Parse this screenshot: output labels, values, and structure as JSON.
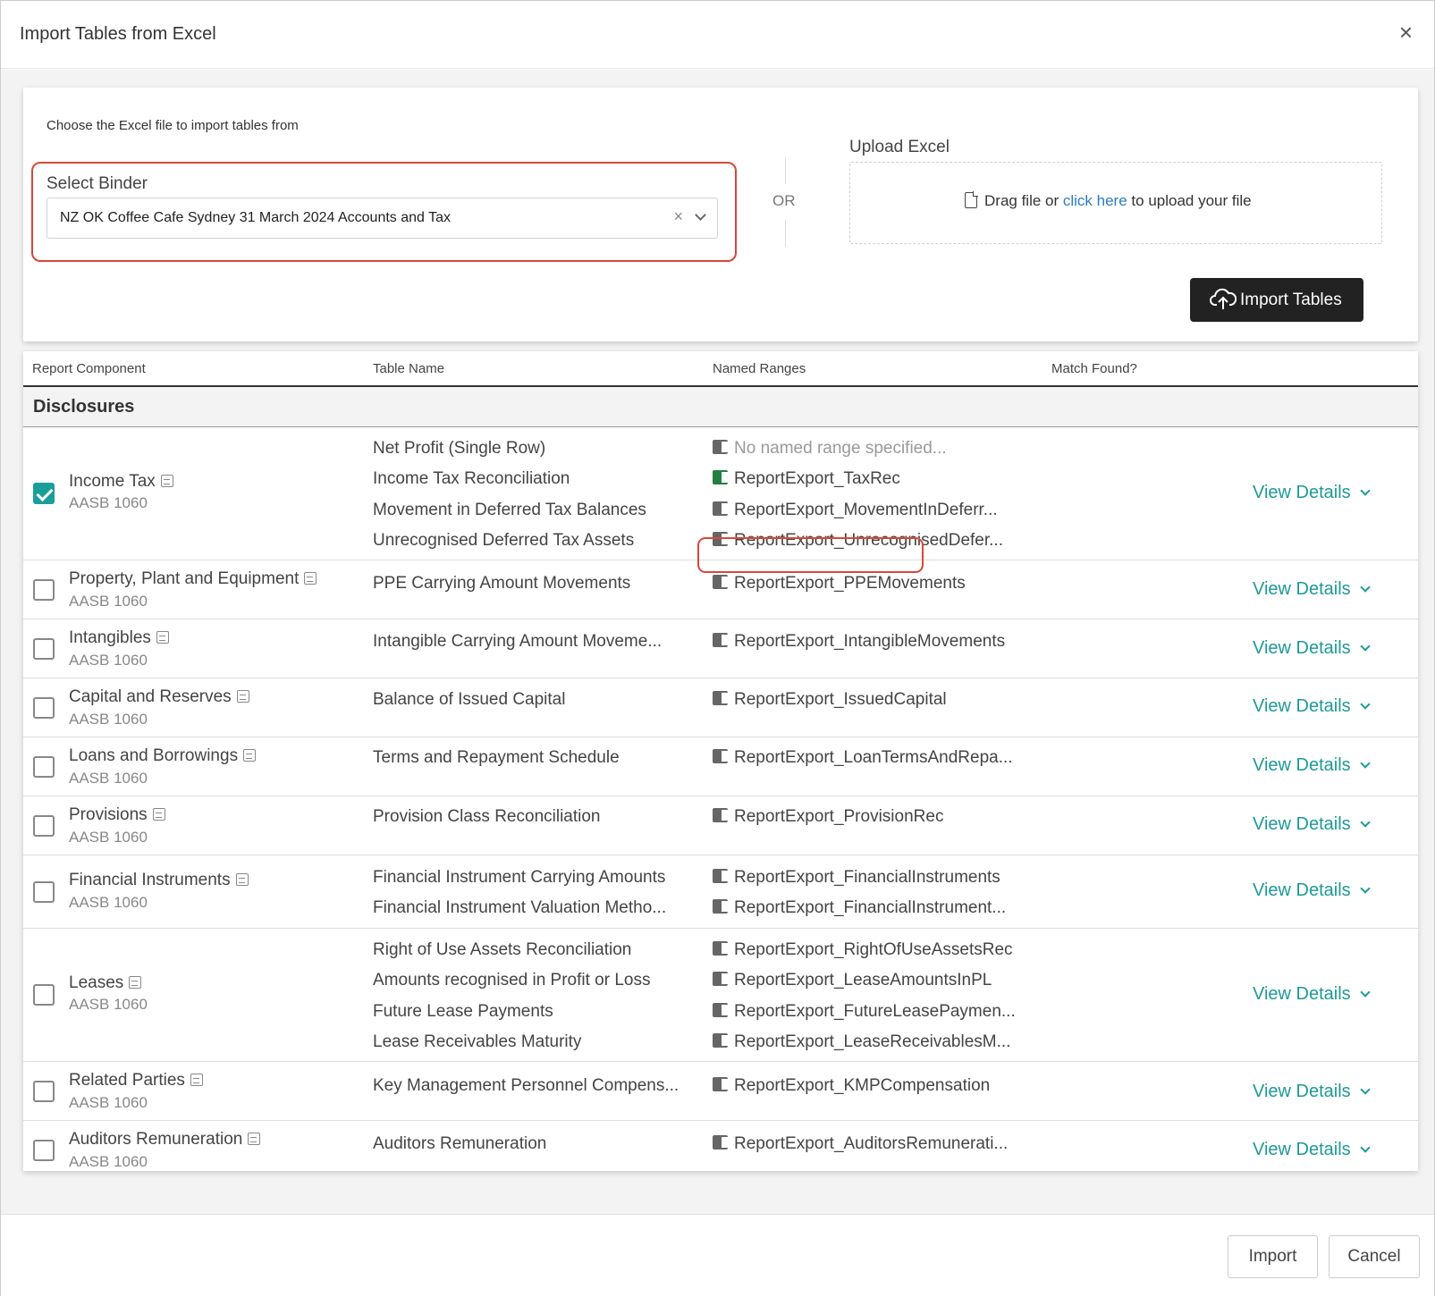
{
  "dialog": {
    "title": "Import Tables from Excel",
    "close_label": "×"
  },
  "upload": {
    "choose_label": "Choose the Excel file to import tables from",
    "binder_label": "Select Binder",
    "binder_value": "NZ OK Coffee Cafe Sydney 31 March 2024 Accounts and Tax",
    "clear_label": "×",
    "or_label": "OR",
    "upload_label": "Upload Excel",
    "drag_text": "Drag file or",
    "click_here": "click here",
    "upload_suffix": "to upload your file",
    "import_tables_label": "Import Tables"
  },
  "table": {
    "headers": [
      "Report Component",
      "Table Name",
      "Named Ranges",
      "Match Found?"
    ],
    "group_title": "Disclosures",
    "view_details_label": "View Details",
    "rows": [
      {
        "name": "Income Tax",
        "standard": "AASB 1060",
        "checked": true,
        "tables": [
          "Net Profit (Single Row)",
          "Income Tax Reconciliation",
          "Movement in Deferred Tax Balances",
          "Unrecognised Deferred Tax Assets"
        ],
        "ranges": [
          "No named range specified...",
          "ReportExport_TaxRec",
          "ReportExport_MovementInDeferr...",
          "ReportExport_UnrecognisedDefer..."
        ]
      },
      {
        "name": "Property, Plant and Equipment",
        "standard": "AASB 1060",
        "checked": false,
        "tables": [
          "PPE Carrying Amount Movements"
        ],
        "ranges": [
          "ReportExport_PPEMovements"
        ]
      },
      {
        "name": "Intangibles",
        "standard": "AASB 1060",
        "checked": false,
        "tables": [
          "Intangible Carrying Amount Moveme..."
        ],
        "ranges": [
          "ReportExport_IntangibleMovements"
        ]
      },
      {
        "name": "Capital and Reserves",
        "standard": "AASB 1060",
        "checked": false,
        "tables": [
          "Balance of Issued Capital"
        ],
        "ranges": [
          "ReportExport_IssuedCapital"
        ]
      },
      {
        "name": "Loans and Borrowings",
        "standard": "AASB 1060",
        "checked": false,
        "tables": [
          "Terms and Repayment Schedule"
        ],
        "ranges": [
          "ReportExport_LoanTermsAndRepa..."
        ]
      },
      {
        "name": "Provisions",
        "standard": "AASB 1060",
        "checked": false,
        "tables": [
          "Provision Class Reconciliation"
        ],
        "ranges": [
          "ReportExport_ProvisionRec"
        ]
      },
      {
        "name": "Financial Instruments",
        "standard": "AASB 1060",
        "checked": false,
        "tables": [
          "Financial Instrument Carrying Amounts",
          "Financial Instrument Valuation Metho..."
        ],
        "ranges": [
          "ReportExport_FinancialInstruments",
          "ReportExport_FinancialInstrument..."
        ]
      },
      {
        "name": "Leases",
        "standard": "AASB 1060",
        "checked": false,
        "tables": [
          "Right of Use Assets Reconciliation",
          "Amounts recognised in Profit or Loss",
          "Future Lease Payments",
          "Lease Receivables Maturity"
        ],
        "ranges": [
          "ReportExport_RightOfUseAssetsRec",
          "ReportExport_LeaseAmountsInPL",
          "ReportExport_FutureLeasePaymen...",
          "ReportExport_LeaseReceivablesM..."
        ]
      },
      {
        "name": "Related Parties",
        "standard": "AASB 1060",
        "checked": false,
        "tables": [
          "Key Management Personnel Compens..."
        ],
        "ranges": [
          "ReportExport_KMPCompensation"
        ]
      },
      {
        "name": "Auditors Remuneration",
        "standard": "AASB 1060",
        "checked": false,
        "tables": [
          "Auditors Remuneration"
        ],
        "ranges": [
          "ReportExport_AuditorsRemunerati..."
        ]
      }
    ]
  },
  "footer": {
    "import_label": "Import",
    "cancel_label": "Cancel"
  },
  "colors": {
    "accent": "#1d9a96",
    "highlight": "#d9473c",
    "excel_green": "#21803f"
  }
}
